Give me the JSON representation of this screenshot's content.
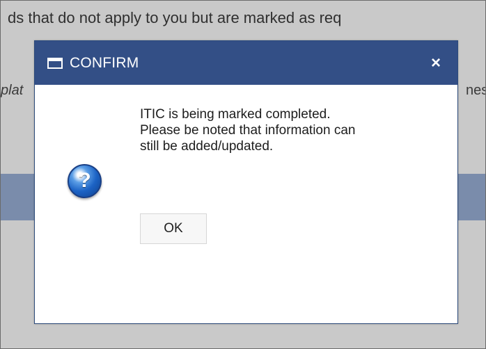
{
  "background": {
    "line1": "ds that do not apply to you but are marked as req",
    "fragment_left": "plat",
    "fragment_right": "nes"
  },
  "dialog": {
    "title": "CONFIRM",
    "close_label": "×",
    "message": "ITIC is being marked completed.\nPlease be noted that information can\nstill be added/updated.",
    "icon": "question-icon",
    "ok_label": "OK"
  },
  "colors": {
    "header": "#334f86",
    "page_background": "#c9c9c9",
    "band": "#7a8cab",
    "icon_blue": "#1c63c5"
  }
}
